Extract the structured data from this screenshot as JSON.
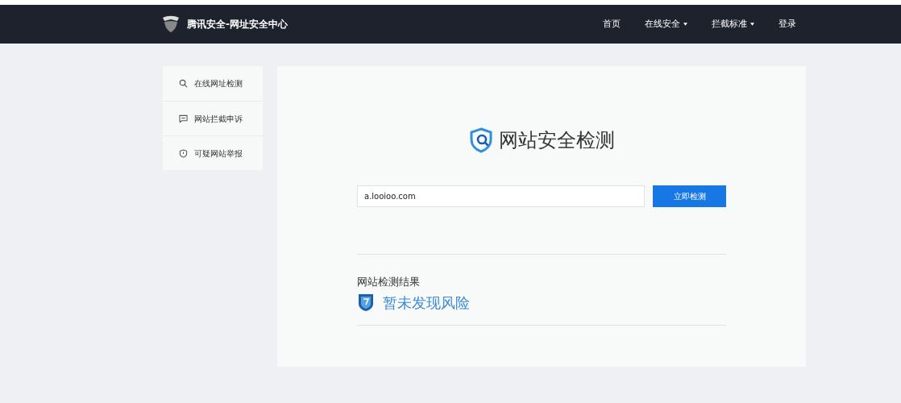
{
  "header": {
    "brand": "腾讯安全-网址安全中心",
    "nav": [
      {
        "label": "首页",
        "dropdown": false
      },
      {
        "label": "在线安全",
        "dropdown": true
      },
      {
        "label": "拦截标准",
        "dropdown": true
      },
      {
        "label": "登录",
        "dropdown": false
      }
    ]
  },
  "sidebar": {
    "items": [
      {
        "kind": "search",
        "label": "在线网址检测"
      },
      {
        "kind": "comment",
        "label": "网站拦截申诉"
      },
      {
        "kind": "shield",
        "label": "可疑网站举报"
      }
    ]
  },
  "main": {
    "title": "网站安全检测",
    "url_field": {
      "value": "a.looioo.com"
    },
    "check_button": "立即检测",
    "result": {
      "heading": "网站检测结果",
      "status": "暂未发现风险"
    }
  }
}
